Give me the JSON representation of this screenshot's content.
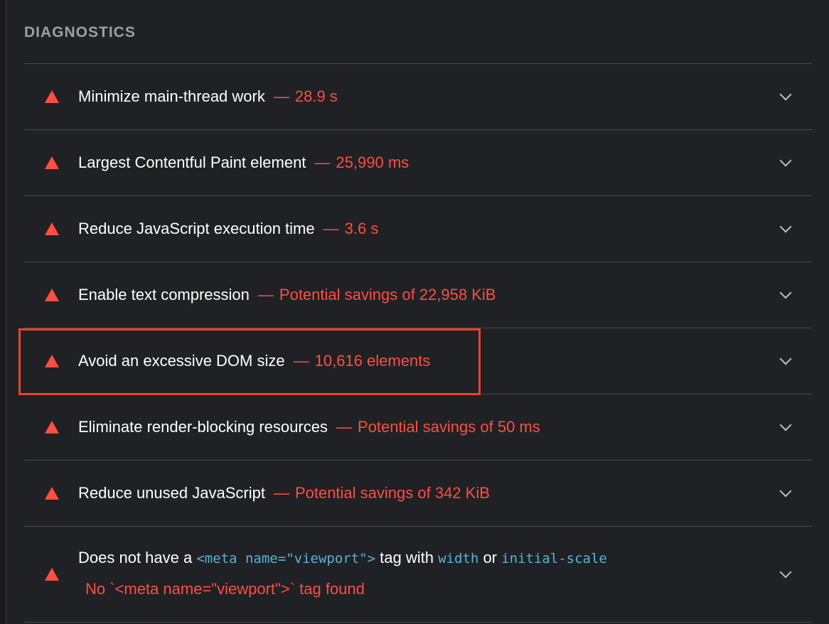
{
  "section": {
    "title": "DIAGNOSTICS"
  },
  "colors": {
    "warning": "#ff4e42",
    "code": "#58b4d6",
    "highlight": "#e8432e"
  },
  "audits": [
    {
      "title": "Minimize main-thread work",
      "separator": "—",
      "value": "28.9 s",
      "icon": "warning-triangle-icon"
    },
    {
      "title": "Largest Contentful Paint element",
      "separator": "—",
      "value": "25,990 ms",
      "icon": "warning-triangle-icon"
    },
    {
      "title": "Reduce JavaScript execution time",
      "separator": "—",
      "value": "3.6 s",
      "icon": "warning-triangle-icon"
    },
    {
      "title": "Enable text compression",
      "separator": "—",
      "value": "Potential savings of 22,958 KiB",
      "icon": "warning-triangle-icon"
    },
    {
      "title": "Avoid an excessive DOM size",
      "separator": "—",
      "value": "10,616 elements",
      "icon": "warning-triangle-icon"
    },
    {
      "title": "Eliminate render-blocking resources",
      "separator": "—",
      "value": "Potential savings of 50 ms",
      "icon": "warning-triangle-icon"
    },
    {
      "title": "Reduce unused JavaScript",
      "separator": "—",
      "value": "Potential savings of 342 KiB",
      "icon": "warning-triangle-icon"
    }
  ],
  "viewport_audit": {
    "part1": "Does not have a",
    "code1": "<meta name=\"viewport\">",
    "part2": "tag with",
    "code2": "width",
    "part3": "or",
    "code3": "initial-scale",
    "detail": "No `<meta name=\"viewport\">` tag found",
    "icon": "warning-triangle-icon"
  }
}
